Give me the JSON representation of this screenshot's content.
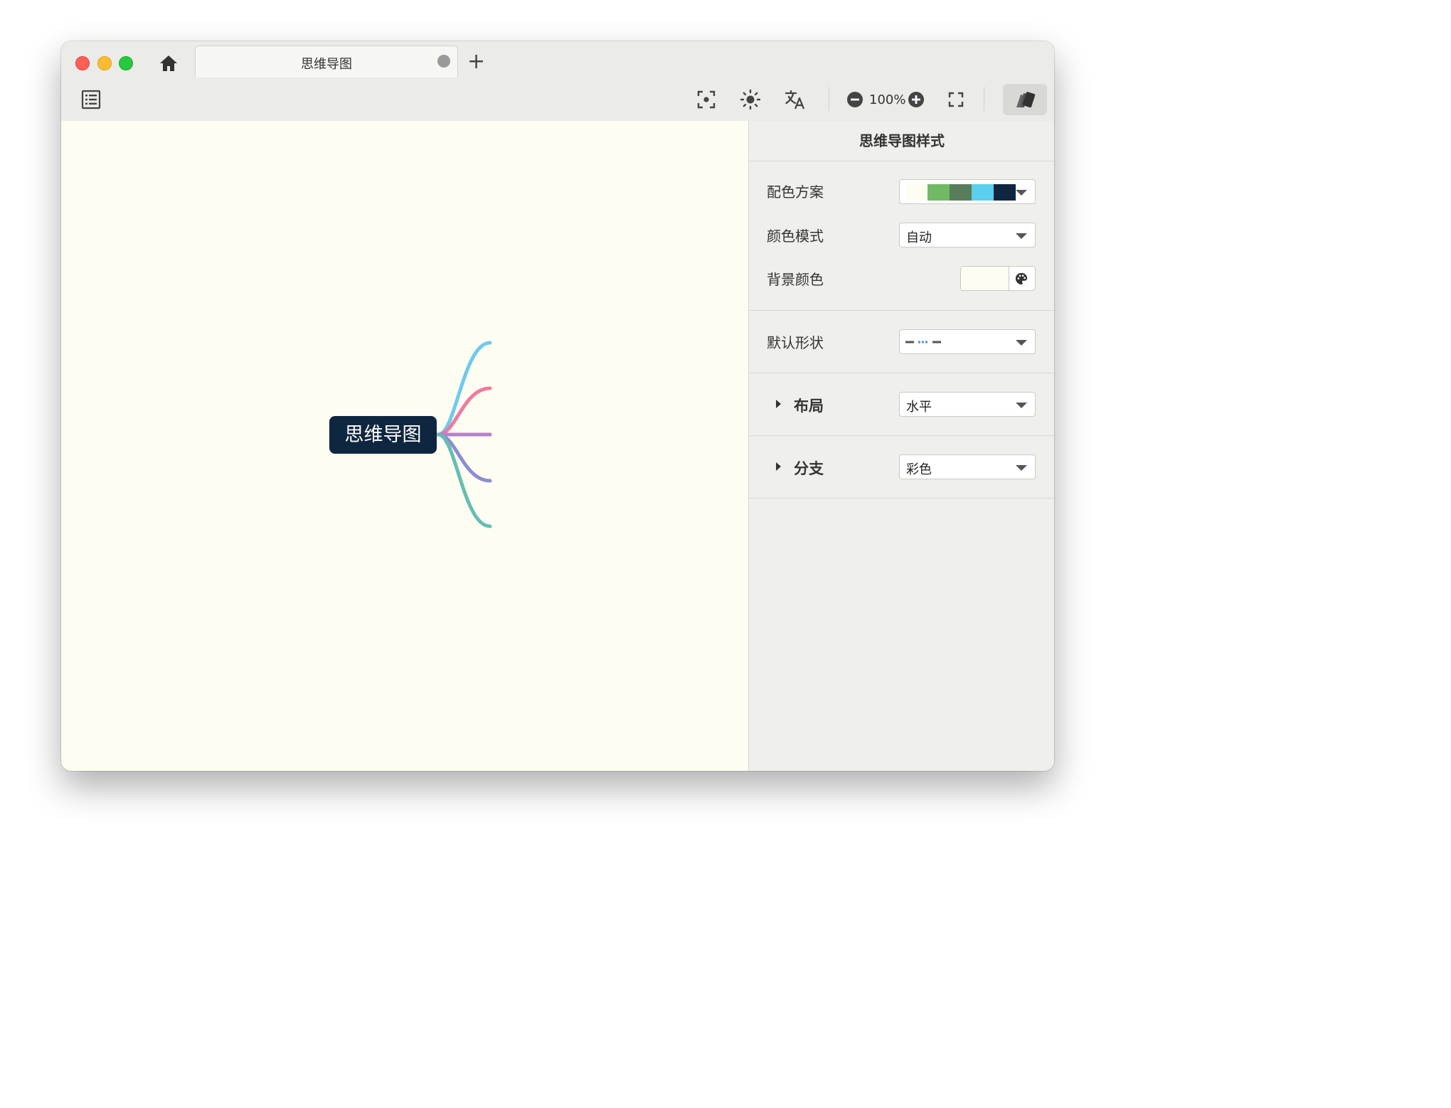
{
  "tab": {
    "title": "思维导图",
    "add_label": "+"
  },
  "toolbar": {
    "zoom_level": "100%",
    "icons": [
      "outline-list-icon",
      "focus-center-icon",
      "brightness-icon",
      "translate-icon",
      "zoom-out-icon",
      "zoom-in-icon",
      "fullscreen-icon",
      "style-panel-icon"
    ]
  },
  "canvas": {
    "background": "#fdfdf2",
    "root": {
      "text": "思维导图",
      "color": "#0f2640"
    },
    "branch_colors": [
      "#6ec9ef",
      "#ef7a9f",
      "#b77fcc",
      "#8a8fd1",
      "#66bdb3"
    ]
  },
  "panel": {
    "title": "思维导图样式",
    "color_scheme": {
      "label": "配色方案",
      "swatches": [
        "#fdfdf2",
        "#72b965",
        "#587d5a",
        "#ef7a9f",
        "#5ccfee",
        "#0f2640"
      ]
    },
    "color_mode": {
      "label": "颜色模式",
      "value": "自动"
    },
    "background_color": {
      "label": "背景颜色",
      "value": "#fdfdf2"
    },
    "default_shape": {
      "label": "默认形状"
    },
    "layout": {
      "label": "布局",
      "value": "水平"
    },
    "branch": {
      "label": "分支",
      "value": "彩色"
    }
  }
}
